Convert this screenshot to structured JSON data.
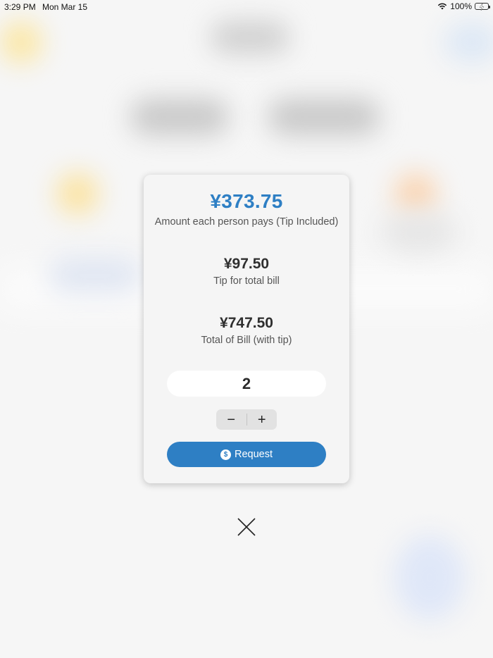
{
  "status_bar": {
    "time": "3:29 PM",
    "date": "Mon Mar 15",
    "battery": "100%"
  },
  "card": {
    "amount_each": "¥373.75",
    "amount_each_label": "Amount each person pays (Tip Included)",
    "tip_total": "¥97.50",
    "tip_total_label": "Tip for total bill",
    "bill_total": "¥747.50",
    "bill_total_label": "Total of Bill (with tip)",
    "people_count": "2",
    "stepper": {
      "decrement": "−",
      "increment": "+"
    },
    "request_button": {
      "icon": "$",
      "label": "Request"
    }
  },
  "colors": {
    "accent": "#2e7fc4",
    "card_background": "#f5f5f5",
    "page_background": "#f6f6f6"
  },
  "icons": {
    "wifi": "wifi-icon",
    "battery": "battery-charging-icon",
    "request": "dollar-circle-icon",
    "close": "close-icon"
  }
}
